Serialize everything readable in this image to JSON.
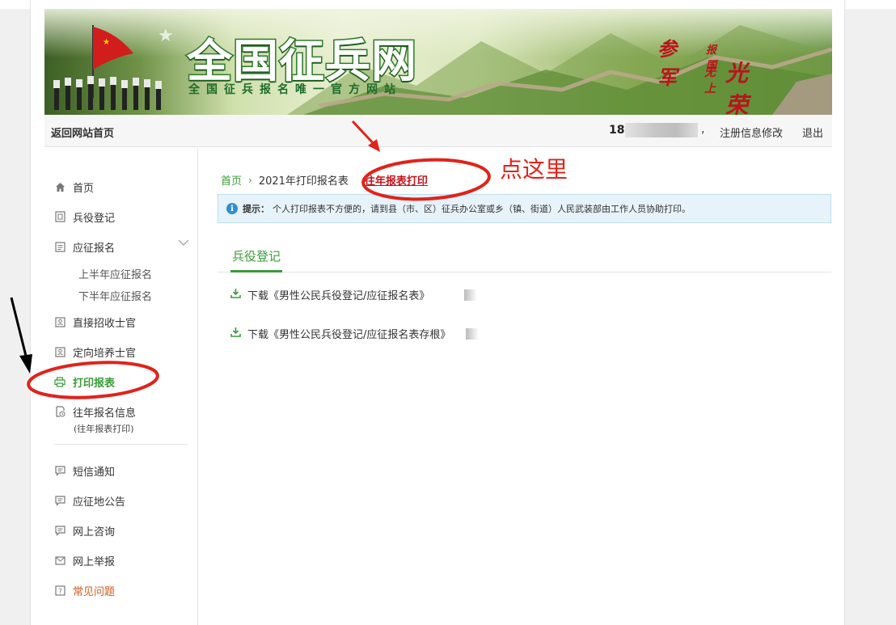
{
  "banner": {
    "site_title": "全国征兵网",
    "site_subtitle": "全国征兵报名唯一官方网站",
    "slogan": {
      "s1": "参军",
      "s2": "报国",
      "s3": "无上",
      "s4": "光荣"
    }
  },
  "navbar": {
    "home_link": "返回网站首页",
    "user_prefix": "18",
    "comma": ",",
    "edit_link": "注册信息修改",
    "logout_link": "退出"
  },
  "sidebar": {
    "items": [
      {
        "label": "首页",
        "icon": "home-icon"
      },
      {
        "label": "兵役登记",
        "icon": "register-icon"
      },
      {
        "label": "应征报名",
        "icon": "form-icon"
      },
      {
        "label": "直接招收士官",
        "icon": "id-card-icon"
      },
      {
        "label": "定向培养士官",
        "icon": "id-card-icon"
      },
      {
        "label": "打印报表",
        "icon": "printer-icon"
      },
      {
        "label": "往年报名信息",
        "icon": "history-icon"
      },
      {
        "label": "短信通知",
        "icon": "message-icon"
      },
      {
        "label": "应征地公告",
        "icon": "message-icon"
      },
      {
        "label": "网上咨询",
        "icon": "message-icon"
      },
      {
        "label": "网上举报",
        "icon": "mail-icon"
      },
      {
        "label": "常见问题",
        "icon": "question-icon"
      }
    ],
    "subitems": [
      "上半年应征报名",
      "下半年应征报名"
    ],
    "history_note": "(往年报表打印)"
  },
  "content": {
    "breadcrumb": {
      "home": "首页",
      "sep": "›",
      "current": "2021年打印报名表",
      "link": "往年报表打印"
    },
    "tip": {
      "icon_glyph": "i",
      "label": "提示：",
      "text": "个人打印报表不方便的，请到县（市、区）征兵办公室或乡（镇、街道）人民武装部由工作人员协助打印。"
    },
    "tab": "兵役登记",
    "downloads": [
      "下载《男性公民兵役登记/应征报名表》",
      "下载《男性公民兵役登记/应征报名表存根》"
    ]
  },
  "annotation": {
    "text": "点这里",
    "color": "#e0231b"
  },
  "colors": {
    "accent_green": "#3a9b3a",
    "link_red": "#c6131b",
    "tip_bg": "#e7f3fa"
  }
}
